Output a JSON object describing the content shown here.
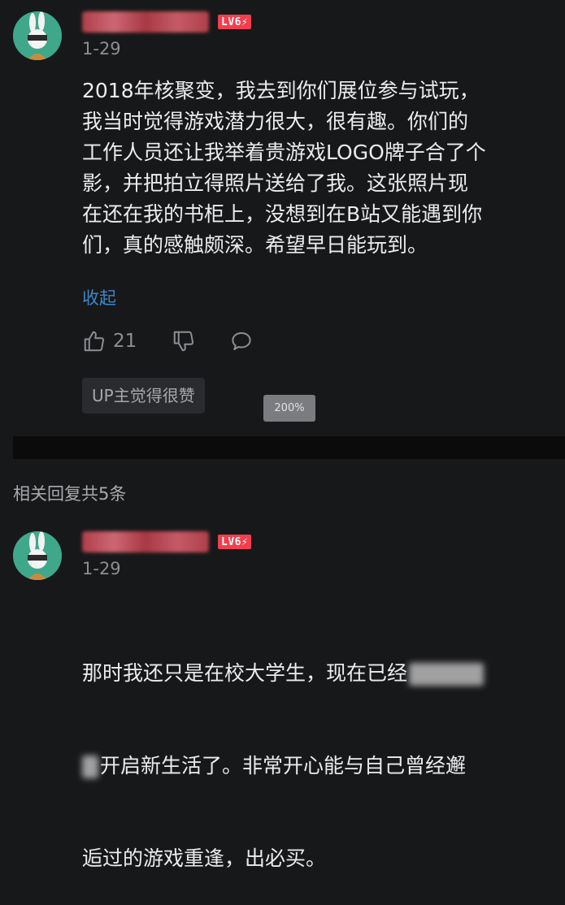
{
  "comment": {
    "level": "LV6",
    "date": "1-29",
    "text": "2018年核聚变，我去到你们展位参与试玩，\n我当时觉得游戏潜力很大，很有趣。你们的\n工作人员还让我举着贵游戏LOGO牌子合了个\n影，并把拍立得照片送给了我。这张照片现\n在还在我的书柜上，没想到在B站又能遇到你\n们，真的感触颇深。希望早日能玩到。",
    "collapse_label": "收起",
    "like_count": "21",
    "up_tag": "UP主觉得很赞"
  },
  "zoom_indicator": "200%",
  "replies_header": "相关回复共5条",
  "reply": {
    "level": "LV6",
    "date": "1-29",
    "line1": "那时我还只是在校大学生，现在已经",
    "line2": "开启新生活了。非常开心能与自己曾经邂",
    "line3": "逅过的游戏重逢，出必买。"
  },
  "colors": {
    "background": "#17181a",
    "level_badge": "#f13f4e",
    "link": "#3f86c8",
    "avatar_bg": "#3fa88a"
  }
}
